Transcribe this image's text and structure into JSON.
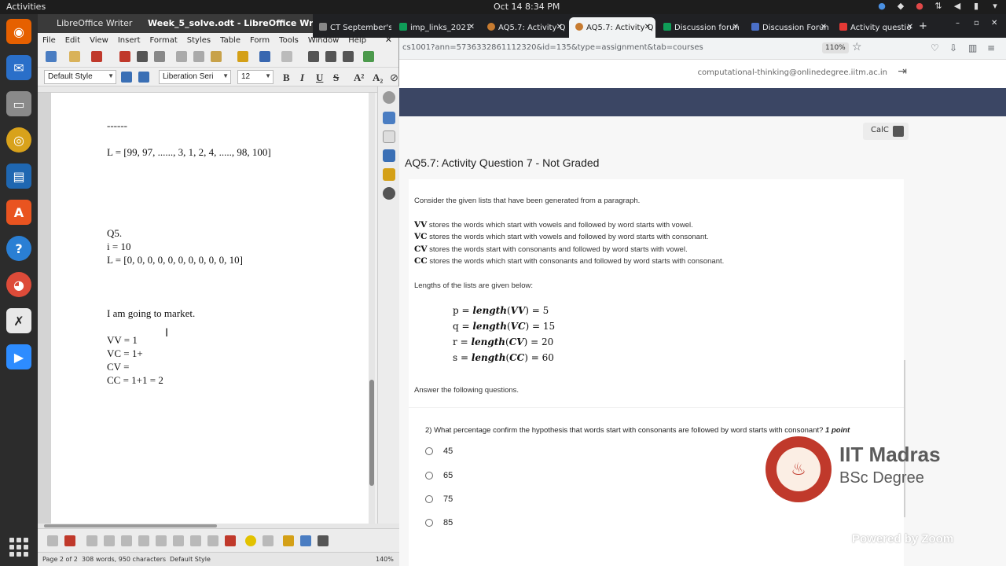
{
  "topbar": {
    "activities": "Activities",
    "clock": "Oct 14  8:34 PM"
  },
  "writer": {
    "app_menu": "LibreOffice Writer",
    "doc_title": "Week_5_solve.odt - LibreOffice Writer",
    "menu": [
      "File",
      "Edit",
      "View",
      "Insert",
      "Format",
      "Styles",
      "Table",
      "Form",
      "Tools",
      "Window",
      "Help"
    ],
    "paragraph_style": "Default Style",
    "font_name": "Liberation Seri",
    "font_size": "12",
    "doc_lines": [
      "------",
      "L = [99, 97, ......, 3, 1, 2, 4, ....., 98, 100]",
      "Q5.",
      "i = 10",
      "L = [0, 0, 0, 0, 0, 0, 0, 0, 0, 0, 10]",
      "I am going to market.",
      "VV = 1",
      "VC = 1+",
      "CV =",
      "CC = 1+1 = 2"
    ],
    "status": {
      "page": "Page 2 of 2",
      "words": "308 words, 950 characters",
      "style": "Default Style",
      "zoom": "140%"
    }
  },
  "browser": {
    "tabs": [
      {
        "label": "CT September's",
        "color": "#888888"
      },
      {
        "label": "imp_links_2021",
        "color": "#0f9d58"
      },
      {
        "label": "AQ5.7: Activity Q",
        "color": "#c77b30"
      },
      {
        "label": "AQ5.7: Activity Q",
        "color": "#c77b30"
      },
      {
        "label": "Discussion forun",
        "color": "#0f9d58"
      },
      {
        "label": "Discussion Forun",
        "color": "#4a6fc7"
      },
      {
        "label": "Activity questio",
        "color": "#e53935"
      }
    ],
    "url": "cs1001?ann=5736332861112320&id=135&type=assignment&tab=courses",
    "zoom": "110%",
    "email": "computational-thinking@onlinedegree.iitm.ac.in",
    "calc_label": "CalC",
    "question_title": "AQ5.7: Activity Question 7 - Not Graded",
    "intro": "Consider the given lists that have been generated from a paragraph.",
    "defs": [
      {
        "key": "VV",
        "text": " stores the words which start with vowels and followed by word starts with vowel."
      },
      {
        "key": "VC",
        "text": " stores the words which start with vowels and followed by word starts with consonant."
      },
      {
        "key": "CV",
        "text": " stores the words start with consonants and followed by word starts with vowel."
      },
      {
        "key": "CC",
        "text": " stores the words which start with consonants and followed by word starts with consonant."
      }
    ],
    "lengths_label": "Lengths of the lists are given below:",
    "lengths": [
      {
        "var": "p",
        "list": "VV",
        "value": "5"
      },
      {
        "var": "q",
        "list": "VC",
        "value": "15"
      },
      {
        "var": "r",
        "list": "CV",
        "value": "20"
      },
      {
        "var": "s",
        "list": "CC",
        "value": "60"
      }
    ],
    "answer_label": "Answer the following questions.",
    "question": "2)  What percentage confirm the hypothesis that words start with consonants are followed by word starts with consonant?",
    "points": "1 point",
    "options": [
      "45",
      "65",
      "75",
      "85"
    ],
    "logo_line1": "IIT Madras",
    "logo_line2": "BSc Degree",
    "watermark": "Powered by Zoom"
  }
}
